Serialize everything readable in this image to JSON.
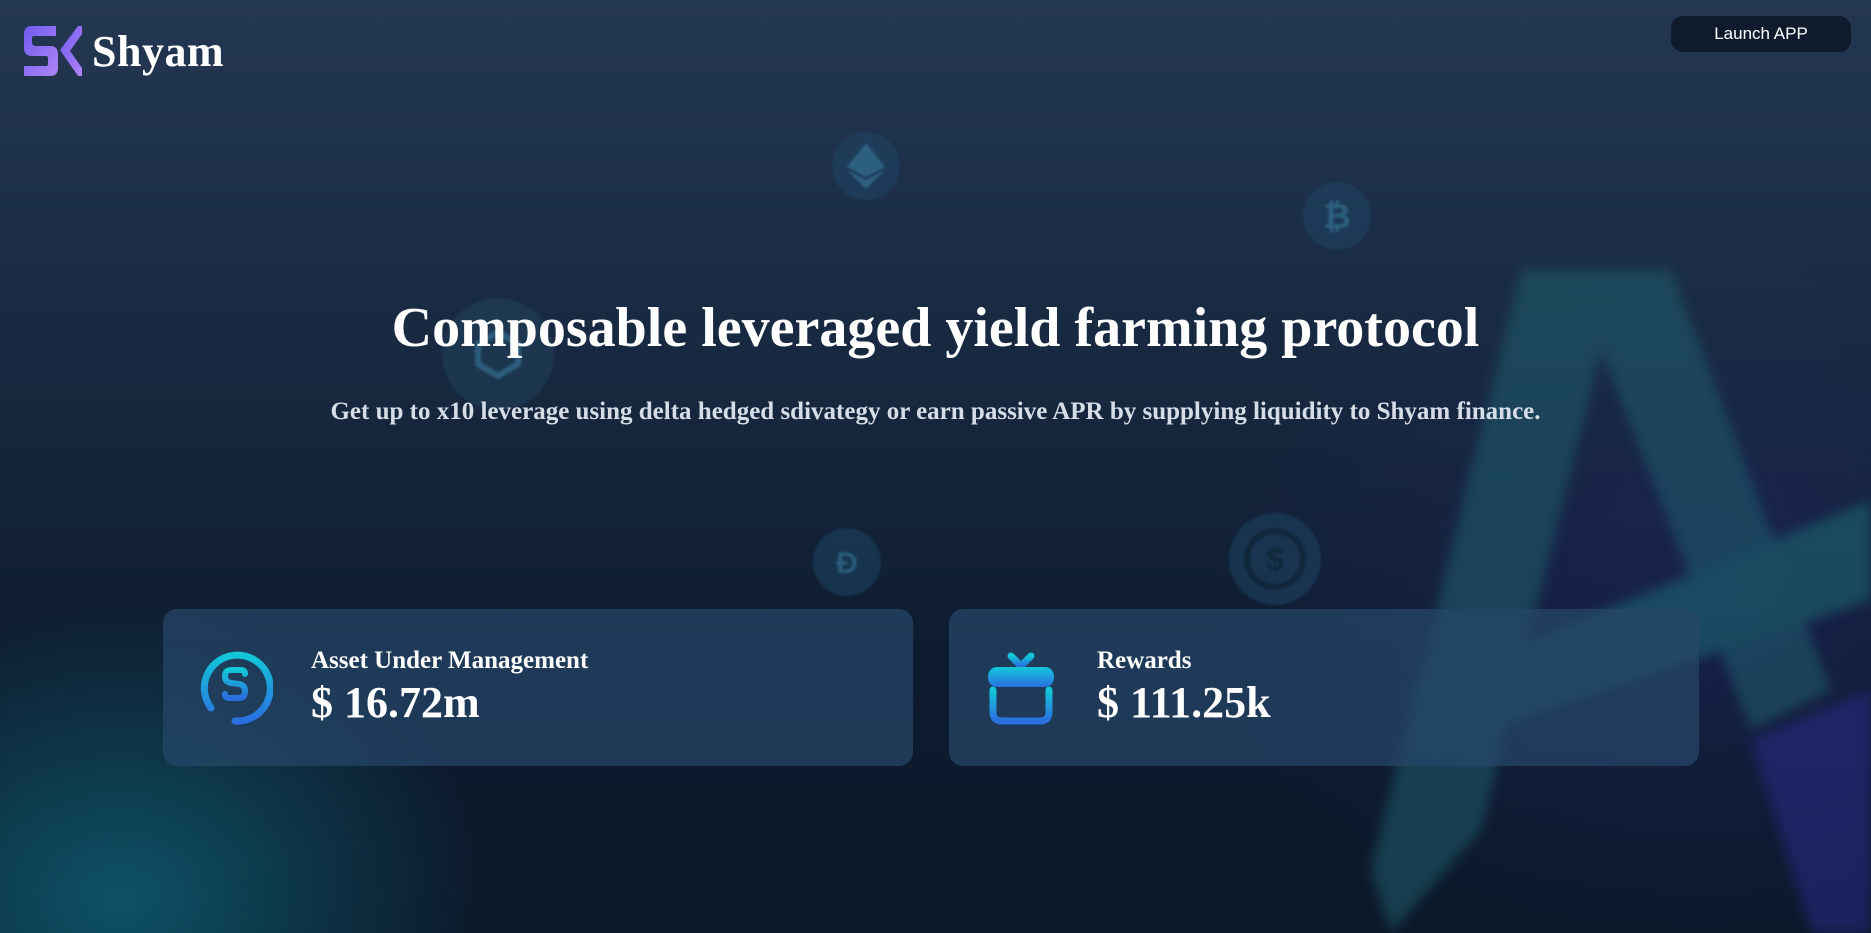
{
  "header": {
    "brand_name": "Shyam",
    "launch_label": "Launch APP"
  },
  "hero": {
    "title": "Composable leveraged yield farming protocol",
    "subtitle": "Get up to x10 leverage using delta hedged sdivategy or earn passive APR by supplying liquidity to Shyam finance."
  },
  "stats": [
    {
      "label": "Asset Under Management",
      "value": "$ 16.72m",
      "icon": "dollar-cycle-icon"
    },
    {
      "label": "Rewards",
      "value": "$ 111.25k",
      "icon": "gift-box-icon"
    }
  ],
  "background_icons": [
    "ethereum-icon",
    "bitcoin-icon",
    "polygon-icon",
    "dai-icon",
    "usdc-icon"
  ],
  "colors": {
    "logo_gradient_start": "#6f5cf0",
    "logo_gradient_end": "#b084f6",
    "icon_gradient_start": "#13c7d8",
    "icon_gradient_end": "#2a6fe0",
    "card_bg": "#264668",
    "button_bg": "#0f1b2c"
  }
}
